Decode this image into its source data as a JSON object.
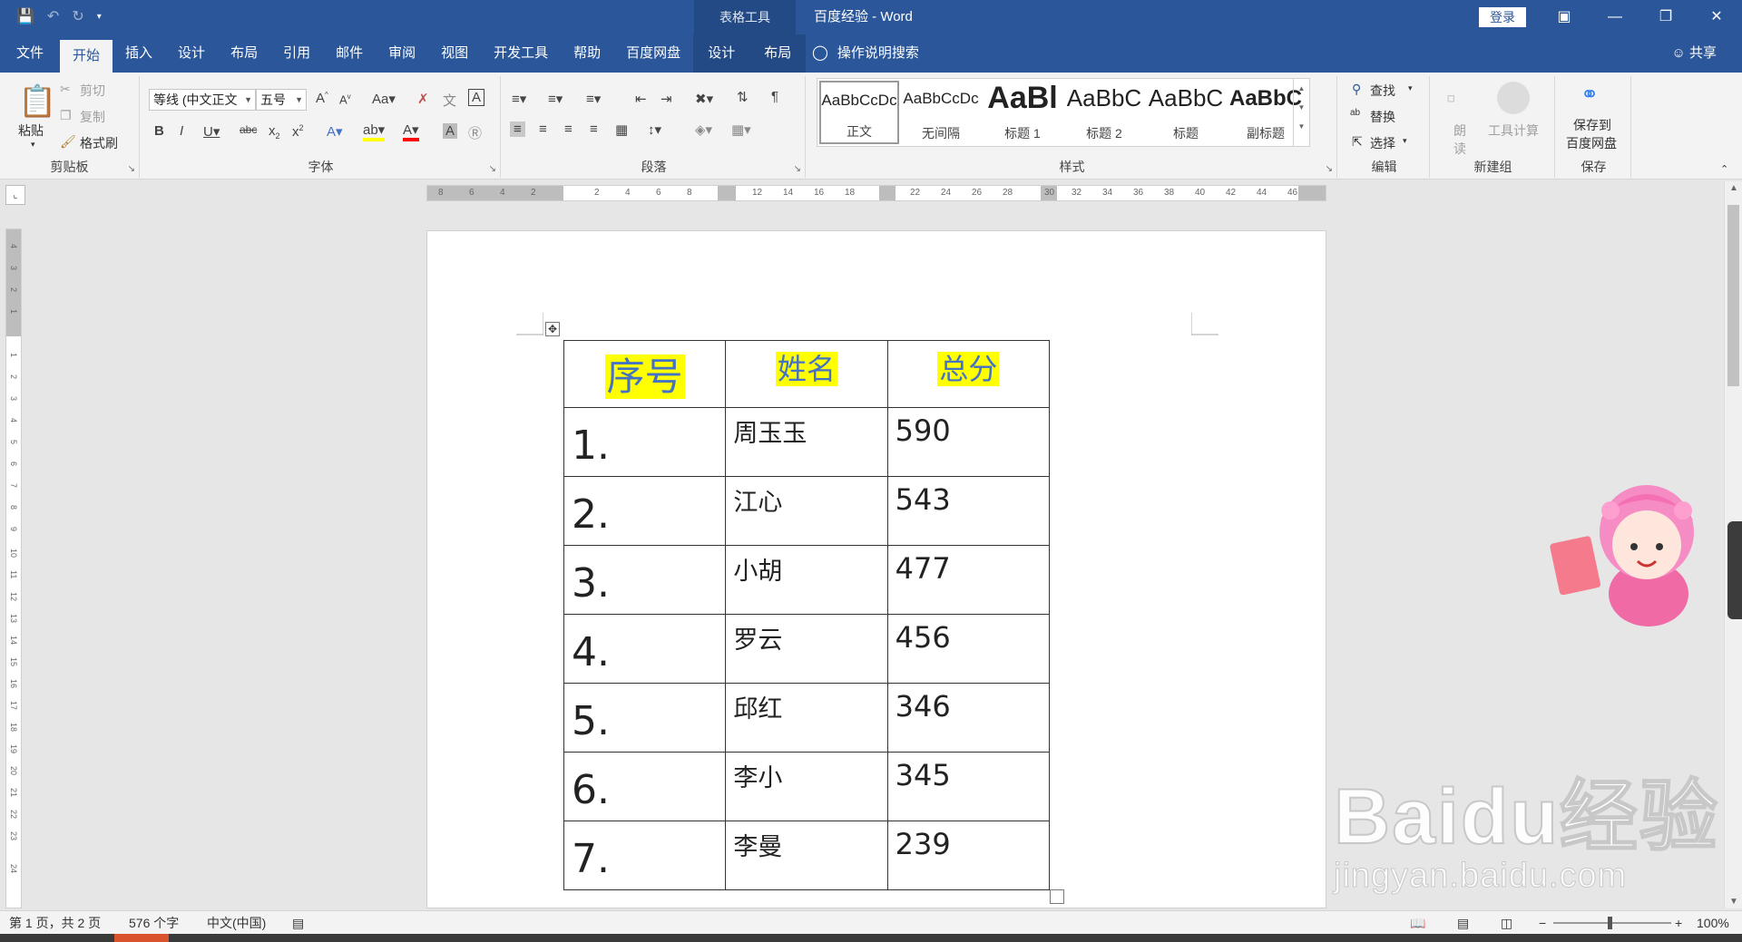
{
  "titlebar": {
    "context_group": "表格工具",
    "doc_title": "百度经验  -  Word",
    "login": "登录"
  },
  "tabs": [
    "文件",
    "开始",
    "插入",
    "设计",
    "布局",
    "引用",
    "邮件",
    "审阅",
    "视图",
    "开发工具",
    "帮助",
    "百度网盘"
  ],
  "context_tabs": [
    "设计",
    "布局"
  ],
  "tell_me": "操作说明搜索",
  "share": "共享",
  "ribbon": {
    "clipboard": {
      "label": "剪贴板",
      "paste": "粘贴",
      "cut": "剪切",
      "copy": "复制",
      "format_painter": "格式刷"
    },
    "font": {
      "label": "字体",
      "font_name": "等线 (中文正文",
      "font_size": "五号"
    },
    "paragraph": {
      "label": "段落"
    },
    "styles": {
      "label": "样式",
      "items": [
        {
          "sample": "AaBbCcDc",
          "name": "正文"
        },
        {
          "sample": "AaBbCcDc",
          "name": "无间隔"
        },
        {
          "sample": "AaBl",
          "name": "标题 1"
        },
        {
          "sample": "AaBbC",
          "name": "标题 2"
        },
        {
          "sample": "AaBbC",
          "name": "标题"
        },
        {
          "sample": "AaBbC",
          "name": "副标题"
        }
      ]
    },
    "editing": {
      "label": "编辑",
      "find": "查找",
      "replace": "替换",
      "select": "选择"
    },
    "new_group": {
      "label": "新建组",
      "read_aloud_1": "朗",
      "read_aloud_2": "读",
      "tool_calc": "工具计算"
    },
    "save": {
      "label": "保存",
      "save_line1": "保存到",
      "save_line2": "百度网盘"
    }
  },
  "hruler_ticks": [
    "8",
    "6",
    "4",
    "2",
    "2",
    "4",
    "6",
    "8",
    "12",
    "14",
    "16",
    "18",
    "22",
    "24",
    "26",
    "28",
    "30",
    "32",
    "34",
    "36",
    "38",
    "40",
    "42",
    "44",
    "46"
  ],
  "vruler_ticks": [
    "4",
    "3",
    "2",
    "1",
    "1",
    "2",
    "3",
    "4",
    "5",
    "6",
    "7",
    "8",
    "9",
    "10",
    "11",
    "12",
    "13",
    "14",
    "15",
    "16",
    "17",
    "18",
    "19",
    "20",
    "21",
    "22",
    "23",
    "24"
  ],
  "table": {
    "headers": [
      "序号",
      "姓名",
      "总分"
    ],
    "rows": [
      {
        "num": "1.",
        "name": "周玉玉",
        "score": "590"
      },
      {
        "num": "2.",
        "name": "江心",
        "score": "543"
      },
      {
        "num": "3.",
        "name": "小胡",
        "score": "477"
      },
      {
        "num": "4.",
        "name": "罗云",
        "score": "456"
      },
      {
        "num": "5.",
        "name": "邱红",
        "score": "346"
      },
      {
        "num": "6.",
        "name": "李小",
        "score": "345"
      },
      {
        "num": "7.",
        "name": "李曼",
        "score": "239"
      }
    ]
  },
  "watermark": {
    "brand": "Baidu经验",
    "url": "jingyan.baidu.com"
  },
  "statusbar": {
    "page": "第 1 页，共 2 页",
    "words": "576 个字",
    "lang": "中文(中国)",
    "zoom": "100%"
  },
  "colors": {
    "word_blue": "#2b579a",
    "highlight": "#ffff00",
    "header_text": "#4472c4"
  }
}
